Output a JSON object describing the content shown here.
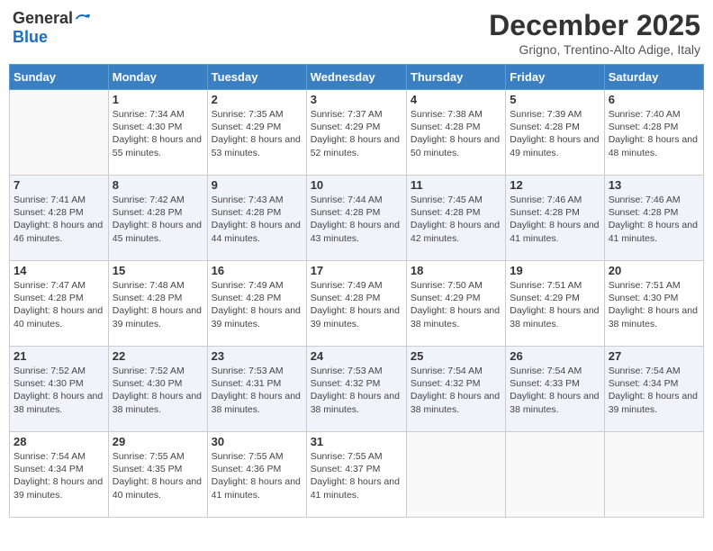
{
  "header": {
    "logo_general": "General",
    "logo_blue": "Blue",
    "month": "December 2025",
    "location": "Grigno, Trentino-Alto Adige, Italy"
  },
  "weekdays": [
    "Sunday",
    "Monday",
    "Tuesday",
    "Wednesday",
    "Thursday",
    "Friday",
    "Saturday"
  ],
  "weeks": [
    [
      {
        "day": "",
        "sunrise": "",
        "sunset": "",
        "daylight": ""
      },
      {
        "day": "1",
        "sunrise": "Sunrise: 7:34 AM",
        "sunset": "Sunset: 4:30 PM",
        "daylight": "Daylight: 8 hours and 55 minutes."
      },
      {
        "day": "2",
        "sunrise": "Sunrise: 7:35 AM",
        "sunset": "Sunset: 4:29 PM",
        "daylight": "Daylight: 8 hours and 53 minutes."
      },
      {
        "day": "3",
        "sunrise": "Sunrise: 7:37 AM",
        "sunset": "Sunset: 4:29 PM",
        "daylight": "Daylight: 8 hours and 52 minutes."
      },
      {
        "day": "4",
        "sunrise": "Sunrise: 7:38 AM",
        "sunset": "Sunset: 4:28 PM",
        "daylight": "Daylight: 8 hours and 50 minutes."
      },
      {
        "day": "5",
        "sunrise": "Sunrise: 7:39 AM",
        "sunset": "Sunset: 4:28 PM",
        "daylight": "Daylight: 8 hours and 49 minutes."
      },
      {
        "day": "6",
        "sunrise": "Sunrise: 7:40 AM",
        "sunset": "Sunset: 4:28 PM",
        "daylight": "Daylight: 8 hours and 48 minutes."
      }
    ],
    [
      {
        "day": "7",
        "sunrise": "Sunrise: 7:41 AM",
        "sunset": "Sunset: 4:28 PM",
        "daylight": "Daylight: 8 hours and 46 minutes."
      },
      {
        "day": "8",
        "sunrise": "Sunrise: 7:42 AM",
        "sunset": "Sunset: 4:28 PM",
        "daylight": "Daylight: 8 hours and 45 minutes."
      },
      {
        "day": "9",
        "sunrise": "Sunrise: 7:43 AM",
        "sunset": "Sunset: 4:28 PM",
        "daylight": "Daylight: 8 hours and 44 minutes."
      },
      {
        "day": "10",
        "sunrise": "Sunrise: 7:44 AM",
        "sunset": "Sunset: 4:28 PM",
        "daylight": "Daylight: 8 hours and 43 minutes."
      },
      {
        "day": "11",
        "sunrise": "Sunrise: 7:45 AM",
        "sunset": "Sunset: 4:28 PM",
        "daylight": "Daylight: 8 hours and 42 minutes."
      },
      {
        "day": "12",
        "sunrise": "Sunrise: 7:46 AM",
        "sunset": "Sunset: 4:28 PM",
        "daylight": "Daylight: 8 hours and 41 minutes."
      },
      {
        "day": "13",
        "sunrise": "Sunrise: 7:46 AM",
        "sunset": "Sunset: 4:28 PM",
        "daylight": "Daylight: 8 hours and 41 minutes."
      }
    ],
    [
      {
        "day": "14",
        "sunrise": "Sunrise: 7:47 AM",
        "sunset": "Sunset: 4:28 PM",
        "daylight": "Daylight: 8 hours and 40 minutes."
      },
      {
        "day": "15",
        "sunrise": "Sunrise: 7:48 AM",
        "sunset": "Sunset: 4:28 PM",
        "daylight": "Daylight: 8 hours and 39 minutes."
      },
      {
        "day": "16",
        "sunrise": "Sunrise: 7:49 AM",
        "sunset": "Sunset: 4:28 PM",
        "daylight": "Daylight: 8 hours and 39 minutes."
      },
      {
        "day": "17",
        "sunrise": "Sunrise: 7:49 AM",
        "sunset": "Sunset: 4:28 PM",
        "daylight": "Daylight: 8 hours and 39 minutes."
      },
      {
        "day": "18",
        "sunrise": "Sunrise: 7:50 AM",
        "sunset": "Sunset: 4:29 PM",
        "daylight": "Daylight: 8 hours and 38 minutes."
      },
      {
        "day": "19",
        "sunrise": "Sunrise: 7:51 AM",
        "sunset": "Sunset: 4:29 PM",
        "daylight": "Daylight: 8 hours and 38 minutes."
      },
      {
        "day": "20",
        "sunrise": "Sunrise: 7:51 AM",
        "sunset": "Sunset: 4:30 PM",
        "daylight": "Daylight: 8 hours and 38 minutes."
      }
    ],
    [
      {
        "day": "21",
        "sunrise": "Sunrise: 7:52 AM",
        "sunset": "Sunset: 4:30 PM",
        "daylight": "Daylight: 8 hours and 38 minutes."
      },
      {
        "day": "22",
        "sunrise": "Sunrise: 7:52 AM",
        "sunset": "Sunset: 4:30 PM",
        "daylight": "Daylight: 8 hours and 38 minutes."
      },
      {
        "day": "23",
        "sunrise": "Sunrise: 7:53 AM",
        "sunset": "Sunset: 4:31 PM",
        "daylight": "Daylight: 8 hours and 38 minutes."
      },
      {
        "day": "24",
        "sunrise": "Sunrise: 7:53 AM",
        "sunset": "Sunset: 4:32 PM",
        "daylight": "Daylight: 8 hours and 38 minutes."
      },
      {
        "day": "25",
        "sunrise": "Sunrise: 7:54 AM",
        "sunset": "Sunset: 4:32 PM",
        "daylight": "Daylight: 8 hours and 38 minutes."
      },
      {
        "day": "26",
        "sunrise": "Sunrise: 7:54 AM",
        "sunset": "Sunset: 4:33 PM",
        "daylight": "Daylight: 8 hours and 38 minutes."
      },
      {
        "day": "27",
        "sunrise": "Sunrise: 7:54 AM",
        "sunset": "Sunset: 4:34 PM",
        "daylight": "Daylight: 8 hours and 39 minutes."
      }
    ],
    [
      {
        "day": "28",
        "sunrise": "Sunrise: 7:54 AM",
        "sunset": "Sunset: 4:34 PM",
        "daylight": "Daylight: 8 hours and 39 minutes."
      },
      {
        "day": "29",
        "sunrise": "Sunrise: 7:55 AM",
        "sunset": "Sunset: 4:35 PM",
        "daylight": "Daylight: 8 hours and 40 minutes."
      },
      {
        "day": "30",
        "sunrise": "Sunrise: 7:55 AM",
        "sunset": "Sunset: 4:36 PM",
        "daylight": "Daylight: 8 hours and 41 minutes."
      },
      {
        "day": "31",
        "sunrise": "Sunrise: 7:55 AM",
        "sunset": "Sunset: 4:37 PM",
        "daylight": "Daylight: 8 hours and 41 minutes."
      },
      {
        "day": "",
        "sunrise": "",
        "sunset": "",
        "daylight": ""
      },
      {
        "day": "",
        "sunrise": "",
        "sunset": "",
        "daylight": ""
      },
      {
        "day": "",
        "sunrise": "",
        "sunset": "",
        "daylight": ""
      }
    ]
  ]
}
